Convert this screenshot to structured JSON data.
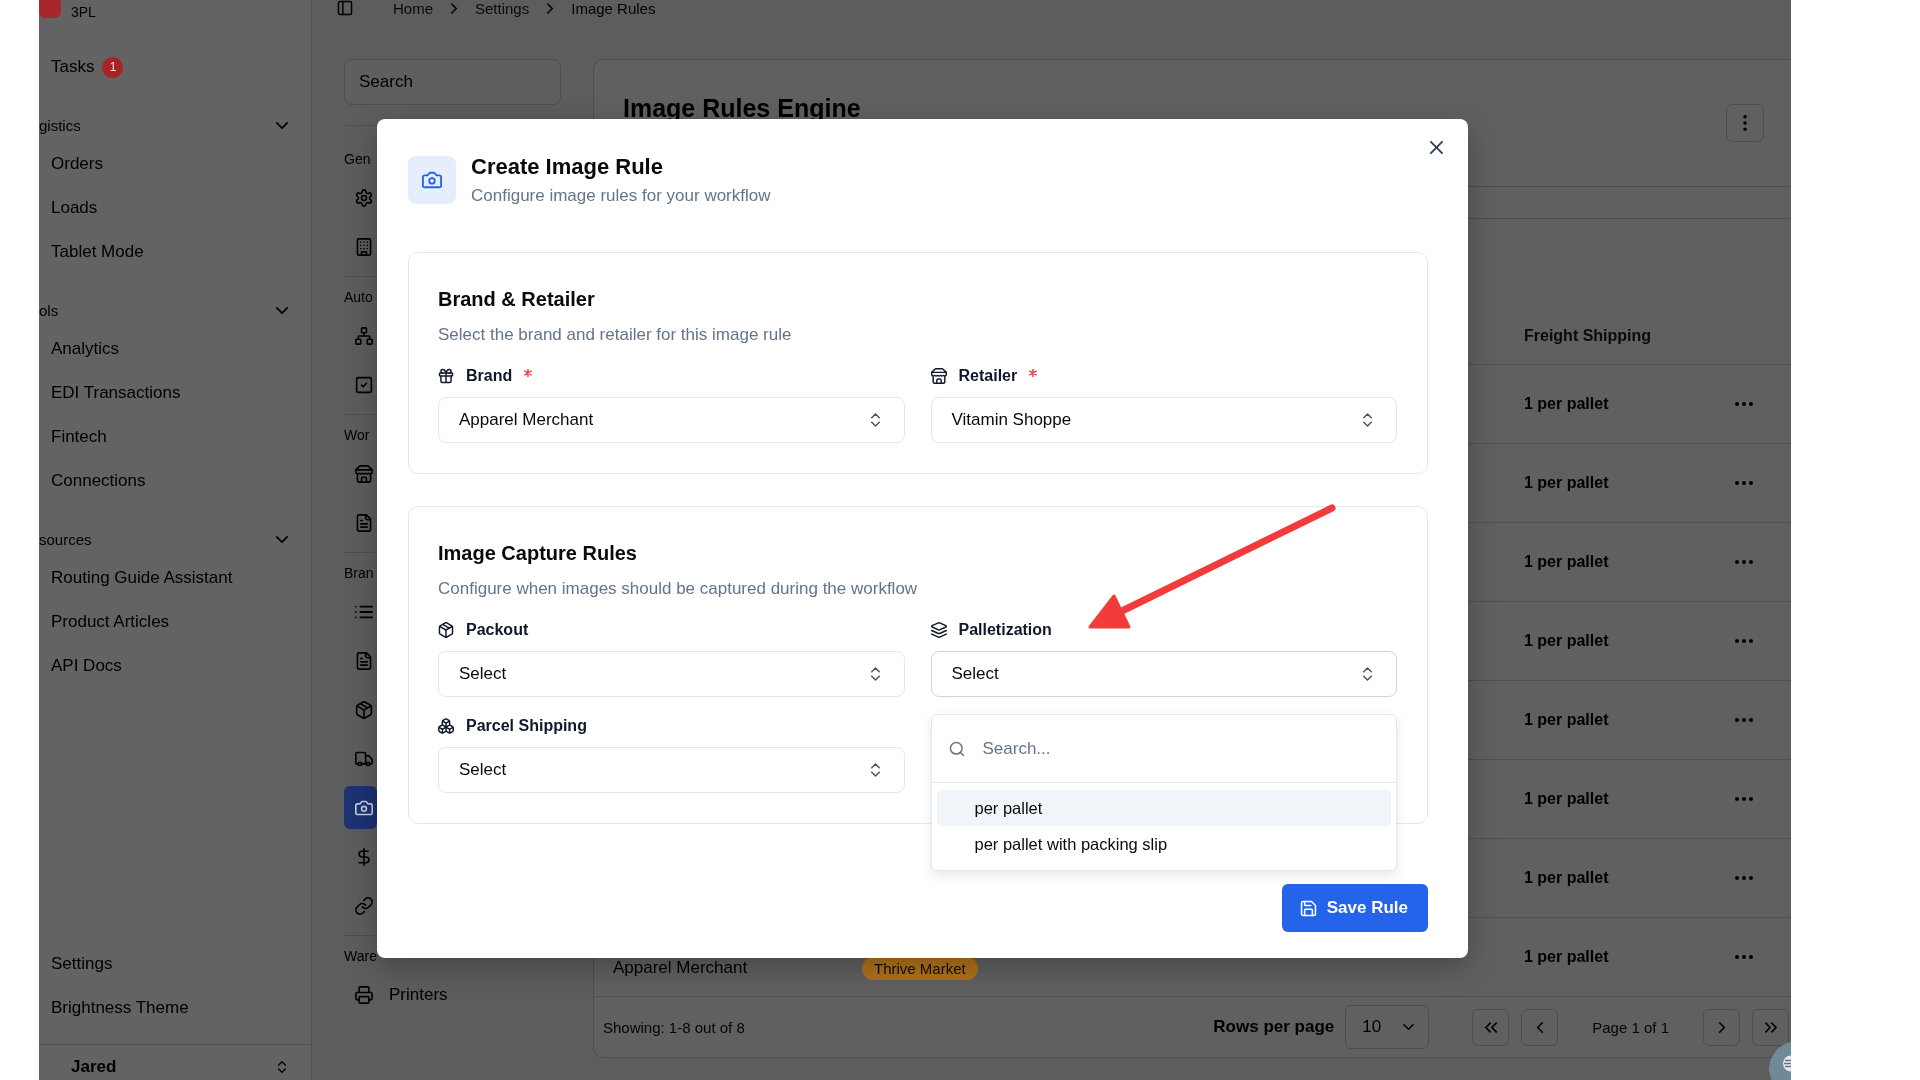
{
  "sidebar": {
    "org": {
      "caption": "3PL"
    },
    "tasks": {
      "label": "Tasks",
      "badge": "1"
    },
    "groups": [
      {
        "title": "gistics",
        "expanded": true,
        "items": [
          {
            "label": "Orders"
          },
          {
            "label": "Loads"
          },
          {
            "label": "Tablet Mode"
          }
        ]
      },
      {
        "title": "ols",
        "expanded": true,
        "items": [
          {
            "label": "Analytics"
          },
          {
            "label": "EDI Transactions"
          },
          {
            "label": "Fintech"
          },
          {
            "label": "Connections"
          }
        ]
      },
      {
        "title": "sources",
        "expanded": true,
        "items": [
          {
            "label": "Routing Guide Assistant"
          },
          {
            "label": "Product Articles"
          },
          {
            "label": "API Docs"
          }
        ]
      }
    ],
    "footer_items": [
      {
        "label": "Settings"
      },
      {
        "label": "Brightness Theme"
      }
    ],
    "user": {
      "name": "Jared"
    }
  },
  "breadcrumb": [
    "Home",
    "Settings",
    "Image Rules"
  ],
  "settings_nav": {
    "search": {
      "placeholder": "Search"
    },
    "sections": [
      {
        "title": "Gen",
        "items": [
          {
            "selected": false
          },
          {
            "selected": false
          }
        ]
      },
      {
        "title": "Auto",
        "items": [
          {
            "selected": false
          },
          {
            "selected": false
          }
        ]
      },
      {
        "title": "Wor",
        "items": [
          {
            "selected": false
          },
          {
            "selected": false
          }
        ]
      },
      {
        "title": "Bran",
        "items": [
          {
            "selected": false
          },
          {
            "selected": false
          },
          {
            "selected": false
          },
          {
            "selected": false
          },
          {
            "selected": true
          },
          {
            "selected": false
          },
          {
            "selected": false
          }
        ]
      },
      {
        "title": "Ware",
        "items": [
          {
            "label": "Printers",
            "selected": false
          }
        ]
      }
    ]
  },
  "page": {
    "title": "Image Rules Engine",
    "table": {
      "freight_shipping_header": "Freight Shipping",
      "rows": [
        {
          "freight_shipping": "1 per pallet"
        },
        {
          "freight_shipping": "1 per pallet"
        },
        {
          "freight_shipping": "1 per pallet"
        },
        {
          "freight_shipping": "1 per pallet"
        },
        {
          "freight_shipping": "1 per pallet"
        },
        {
          "freight_shipping": "1 per pallet"
        },
        {
          "freight_shipping": "1 per pallet"
        },
        {
          "column_1": "Apparel Merchant",
          "column_2": "Thrive Market",
          "freight_shipping": "1 per pallet"
        }
      ]
    },
    "pagination": {
      "summary": "Showing: 1-8 out of 8",
      "rows_per_page_label": "Rows per page",
      "rows_per_page": "10",
      "page_label": "Page 1 of 1"
    }
  },
  "dialog": {
    "title": "Create Image Rule",
    "subtitle": "Configure image rules for your workflow",
    "sections": [
      {
        "title": "Brand & Retailer",
        "description": "Select the brand and retailer for this image rule",
        "fields": [
          {
            "label": "Brand",
            "required": true,
            "value": "Apparel Merchant",
            "expanded": false
          },
          {
            "label": "Retailer",
            "required": true,
            "value": "Vitamin Shoppe",
            "expanded": false
          }
        ]
      },
      {
        "title": "Image Capture Rules",
        "description": "Configure when images should be captured during the workflow",
        "fields": [
          {
            "label": "Packout",
            "required": false,
            "value": "Select",
            "expanded": false
          },
          {
            "label": "Palletization",
            "required": false,
            "value": "Select",
            "expanded": true,
            "search_placeholder": "Search...",
            "options": [
              {
                "label": "per pallet",
                "selected": true
              },
              {
                "label": "per pallet with packing slip",
                "selected": false
              }
            ]
          },
          {
            "label": "Parcel Shipping",
            "required": false,
            "value": "Select",
            "expanded": false
          }
        ]
      }
    ],
    "save_button": {
      "label": "Save Rule"
    }
  }
}
